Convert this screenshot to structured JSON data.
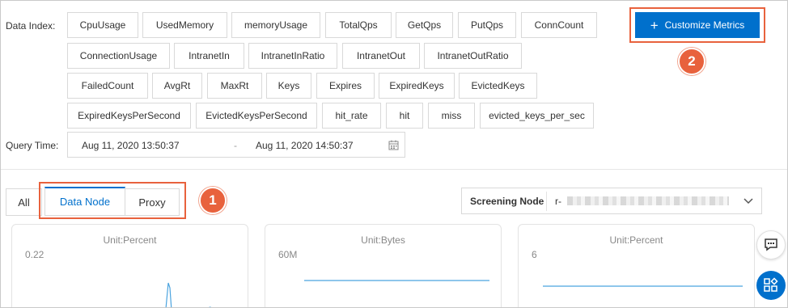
{
  "filters": {
    "data_index_label": "Data Index:",
    "query_time_label": "Query Time:",
    "metrics": [
      "CpuUsage",
      "UsedMemory",
      "memoryUsage",
      "TotalQps",
      "GetQps",
      "PutQps",
      "ConnCount",
      "ConnectionUsage",
      "IntranetIn",
      "IntranetInRatio",
      "IntranetOut",
      "IntranetOutRatio",
      "FailedCount",
      "AvgRt",
      "MaxRt",
      "Keys",
      "Expires",
      "ExpiredKeys",
      "EvictedKeys",
      "ExpiredKeysPerSecond",
      "EvictedKeysPerSecond",
      "hit_rate",
      "hit",
      "miss",
      "evicted_keys_per_sec"
    ],
    "customize_label": "Customize Metrics",
    "start_time": "Aug 11, 2020 13:50:37",
    "range_separator": "-",
    "end_time": "Aug 11, 2020 14:50:37"
  },
  "tabs": {
    "all": "All",
    "data_node": "Data Node",
    "proxy": "Proxy"
  },
  "screening": {
    "label": "Screening Node",
    "value": "r-"
  },
  "callouts": {
    "one": "1",
    "two": "2"
  },
  "charts": [
    {
      "unit": "Unit:Percent",
      "ymax": "0.22"
    },
    {
      "unit": "Unit:Bytes",
      "ymax": "60M"
    },
    {
      "unit": "Unit:Percent",
      "ymax": "6"
    }
  ],
  "colors": {
    "accent": "#0070cc",
    "callout": "#e8623d",
    "series": "#4aa3df"
  },
  "icons": {
    "calendar": "calendar-icon",
    "chevron": "chevron-down-icon",
    "chat": "chat-icon",
    "apps": "apps-icon",
    "plus": "plus-icon"
  }
}
